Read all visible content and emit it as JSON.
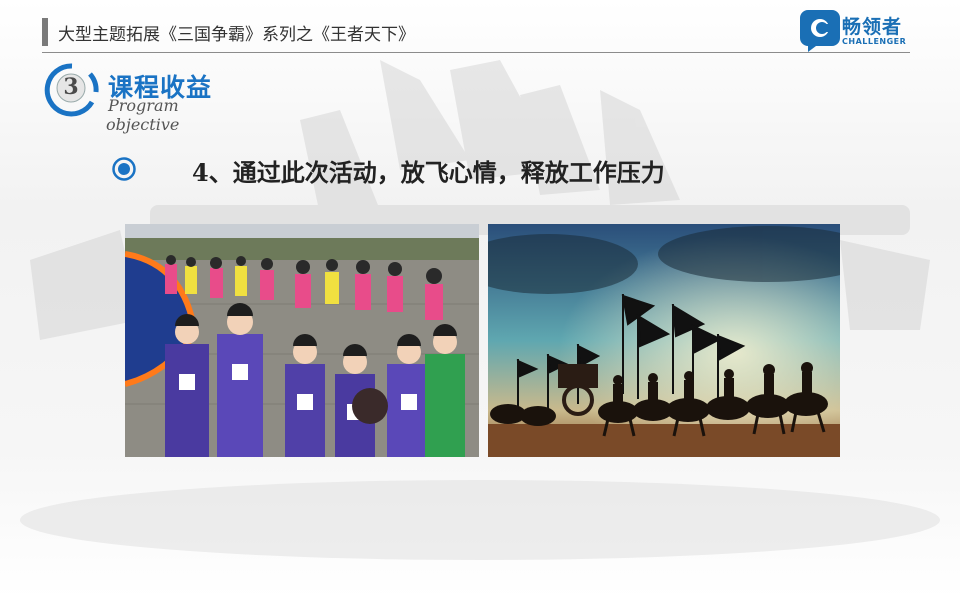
{
  "header": {
    "title": "大型主题拓展《三国争霸》系列之《王者天下》"
  },
  "logo": {
    "name": "畅领者",
    "subtitle": "CHALLENGER",
    "brand_color": "#1a6fb5"
  },
  "section": {
    "number": "3",
    "title": "课程收益",
    "subtitle_line1": "Program",
    "subtitle_line2": "objective",
    "accent_color": "#1a73c4"
  },
  "point": {
    "text": "4、通过此次活动，放飞心情，释放工作压力"
  },
  "photos": [
    {
      "name": "team-activity-photo"
    },
    {
      "name": "ancient-cavalry-photo"
    }
  ]
}
